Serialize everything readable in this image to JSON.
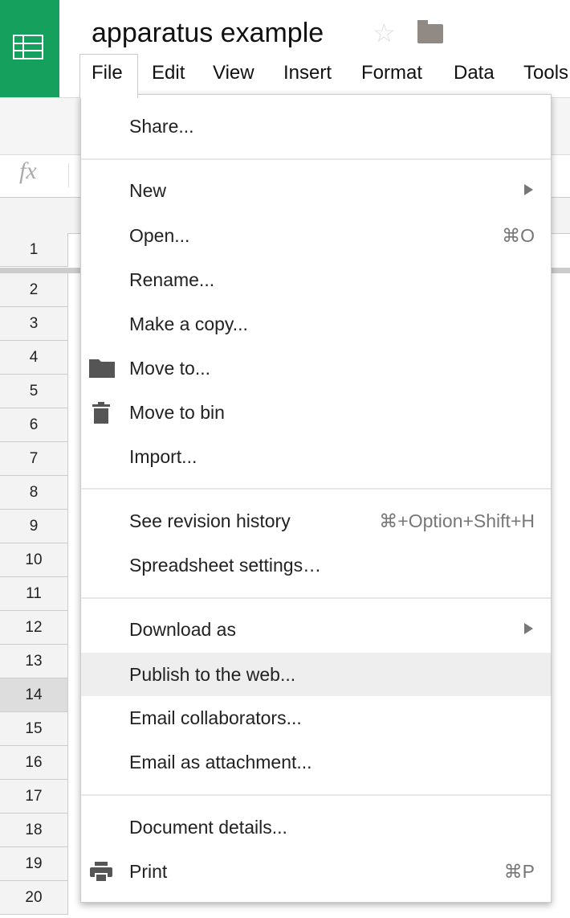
{
  "doc_title": "apparatus example",
  "menubar": [
    "File",
    "Edit",
    "View",
    "Insert",
    "Format",
    "Data",
    "Tools"
  ],
  "fx_label": "fx",
  "rows": [
    "1",
    "2",
    "3",
    "4",
    "5",
    "6",
    "7",
    "8",
    "9",
    "10",
    "11",
    "12",
    "13",
    "14",
    "15",
    "16",
    "17",
    "18",
    "19",
    "20"
  ],
  "selected_row": "14",
  "file_menu": {
    "share": "Share...",
    "new": "New",
    "open": "Open...",
    "open_sc": "⌘O",
    "rename": "Rename...",
    "copy": "Make a copy...",
    "move": "Move to...",
    "bin": "Move to bin",
    "import": "Import...",
    "revision": "See revision history",
    "revision_sc": "⌘+Option+Shift+H",
    "settings": "Spreadsheet settings…",
    "download": "Download as",
    "publish": "Publish to the web...",
    "email_collab": "Email collaborators...",
    "email_attach": "Email as attachment...",
    "details": "Document details...",
    "print": "Print",
    "print_sc": "⌘P"
  },
  "colors": {
    "brand": "#16a05d",
    "highlight": "#eeeeee"
  }
}
